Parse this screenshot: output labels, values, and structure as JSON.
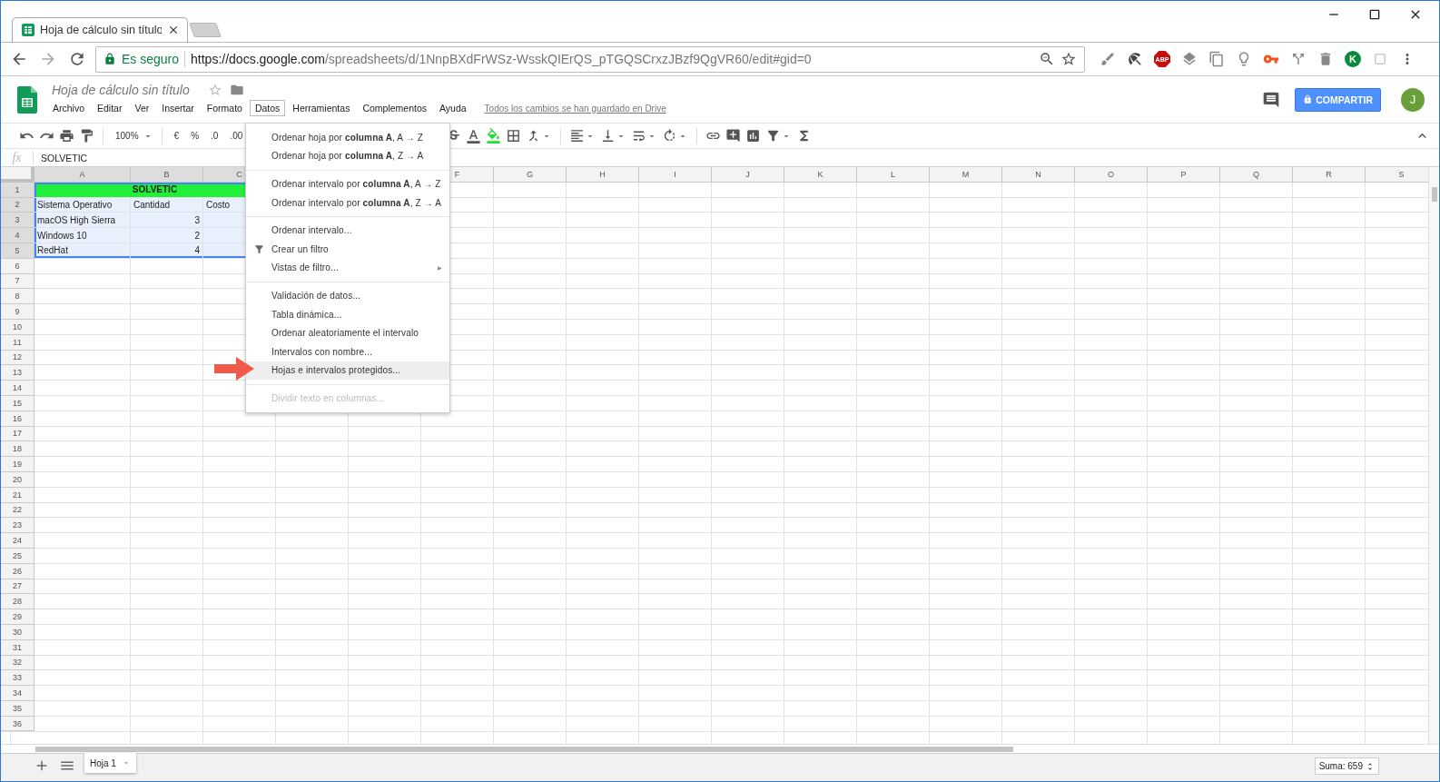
{
  "browser": {
    "tabs": [
      {
        "title": "Hoja de cálculo sin título",
        "selected": true
      }
    ],
    "security": "Es seguro",
    "url_host": "https://docs.google.com",
    "url_path": "/spreadsheets/d/1NnpBXdFrWSz-WsskQIErQS_pTGQSCrxzJBzf9QgVR60/edit#gid=0",
    "abp_label": "ABP",
    "k_label": "K"
  },
  "doc": {
    "title": "Hoja de cálculo sin título",
    "starred": false,
    "save_status": "Todos los cambios se han guardado en Drive",
    "menu": [
      {
        "label": "Archivo",
        "selected": false
      },
      {
        "label": "Editar",
        "selected": false
      },
      {
        "label": "Ver",
        "selected": false
      },
      {
        "label": "Insertar",
        "selected": false
      },
      {
        "label": "Formato",
        "selected": false
      },
      {
        "label": "Datos",
        "selected": true
      },
      {
        "label": "Herramientas",
        "selected": false
      },
      {
        "label": "Complementos",
        "selected": false
      },
      {
        "label": "Ayuda",
        "selected": false
      }
    ],
    "share_button": "COMPARTIR",
    "avatar": "J"
  },
  "toolbar": {
    "zoom": "100%",
    "currency": "€",
    "percent": "%",
    "decimals_less": ".0",
    "decimals_more": ".00"
  },
  "formula_bar": {
    "fx": "fx",
    "value": "SOLVETIC"
  },
  "sheet": {
    "columns": [
      {
        "label": "A",
        "selected": true
      },
      {
        "label": "B",
        "selected": true
      },
      {
        "label": "C",
        "selected": true
      },
      {},
      {},
      {
        "label": "F",
        "selected": false
      },
      {
        "label": "G",
        "selected": false
      },
      {
        "label": "H",
        "selected": false
      },
      {
        "label": "I",
        "selected": false
      },
      {
        "label": "J",
        "selected": false
      },
      {
        "label": "K",
        "selected": false
      },
      {
        "label": "L",
        "selected": false
      },
      {
        "label": "M",
        "selected": false
      },
      {
        "label": "N",
        "selected": false
      },
      {
        "label": "O",
        "selected": false
      },
      {
        "label": "P",
        "selected": false
      },
      {
        "label": "Q",
        "selected": false
      },
      {
        "label": "R",
        "selected": false
      },
      {
        "label": "S",
        "selected": false
      }
    ],
    "rows": [
      {
        "number": "1",
        "selected": true,
        "cells": [
          {
            "kind": "banner",
            "text": "SOLVETIC"
          }
        ]
      },
      {
        "number": "2",
        "selected": true,
        "cells": [
          {
            "kind": "text",
            "text": "Sistema Operativo"
          },
          {
            "kind": "text",
            "text": "Cantidad"
          },
          {
            "kind": "text",
            "text": "Costo"
          }
        ]
      },
      {
        "number": "3",
        "selected": true,
        "cells": [
          {
            "kind": "text",
            "text": "macOS High Sierra"
          },
          {
            "kind": "number",
            "text": "3"
          }
        ]
      },
      {
        "number": "4",
        "selected": true,
        "cells": [
          {
            "kind": "text",
            "text": "Windows 10"
          },
          {
            "kind": "number",
            "text": "2"
          }
        ]
      },
      {
        "number": "5",
        "selected": true,
        "cells": [
          {
            "kind": "text",
            "text": "RedHat"
          },
          {
            "kind": "number",
            "text": "4"
          }
        ]
      },
      {
        "number": "6",
        "selected": false
      },
      {
        "number": "7",
        "selected": false
      },
      {
        "number": "8",
        "selected": false
      },
      {
        "number": "9",
        "selected": false
      },
      {
        "number": "10",
        "selected": false
      },
      {
        "number": "11",
        "selected": false
      },
      {
        "number": "12",
        "selected": false
      },
      {
        "number": "13",
        "selected": false
      },
      {
        "number": "14",
        "selected": false
      },
      {
        "number": "15",
        "selected": false
      },
      {
        "number": "16",
        "selected": false
      },
      {
        "number": "17",
        "selected": false
      },
      {
        "number": "18",
        "selected": false
      },
      {
        "number": "19",
        "selected": false
      },
      {
        "number": "20",
        "selected": false
      },
      {
        "number": "21",
        "selected": false
      },
      {
        "number": "22",
        "selected": false
      },
      {
        "number": "23",
        "selected": false
      },
      {
        "number": "24",
        "selected": false
      },
      {
        "number": "25",
        "selected": false
      },
      {
        "number": "26",
        "selected": false
      },
      {
        "number": "27",
        "selected": false
      },
      {
        "number": "28",
        "selected": false
      },
      {
        "number": "29",
        "selected": false
      },
      {
        "number": "30",
        "selected": false
      },
      {
        "number": "31",
        "selected": false
      },
      {
        "number": "32",
        "selected": false
      },
      {
        "number": "33",
        "selected": false
      },
      {
        "number": "34",
        "selected": false
      },
      {
        "number": "35",
        "selected": false
      },
      {
        "number": "36",
        "selected": false
      }
    ]
  },
  "data_menu": {
    "items": [
      {
        "kind": "item",
        "label": "Ordenar hoja por **columna A**, A → Z",
        "selected": false,
        "disabled": false
      },
      {
        "kind": "item",
        "label": "Ordenar hoja por **columna A**, Z → A",
        "selected": false,
        "disabled": false
      },
      {
        "kind": "separator"
      },
      {
        "kind": "item",
        "label": "Ordenar intervalo por **columna A**, A → Z",
        "selected": false,
        "disabled": false
      },
      {
        "kind": "item",
        "label": "Ordenar intervalo por **columna A**, Z → A",
        "selected": false,
        "disabled": false
      },
      {
        "kind": "separator"
      },
      {
        "kind": "item",
        "label": "Ordenar intervalo...",
        "selected": false,
        "disabled": false
      },
      {
        "kind": "icon-item",
        "label": "Crear un filtro",
        "selected": false,
        "disabled": false
      },
      {
        "kind": "submenu",
        "label": "Vistas de filtro...",
        "arrow": "▶",
        "selected": false,
        "disabled": false
      },
      {
        "kind": "separator"
      },
      {
        "kind": "item",
        "label": "Validación de datos...",
        "selected": false,
        "disabled": false
      },
      {
        "kind": "item",
        "label": "Tabla dinámica...",
        "selected": false,
        "disabled": false
      },
      {
        "kind": "item",
        "label": "Ordenar aleatoriamente el intervalo",
        "selected": false,
        "disabled": false
      },
      {
        "kind": "item",
        "label": "Intervalos con nombre...",
        "selected": false,
        "disabled": false
      },
      {
        "kind": "item",
        "label": "Hojas e intervalos protegidos...",
        "selected": true,
        "disabled": false
      },
      {
        "kind": "separator"
      },
      {
        "kind": "item",
        "label": "Dividir texto en columnas...",
        "selected": false,
        "disabled": true
      }
    ]
  },
  "sheet_tabs": [
    {
      "label": "Hoja 1",
      "selected": true
    }
  ],
  "status": "Suma: 659"
}
